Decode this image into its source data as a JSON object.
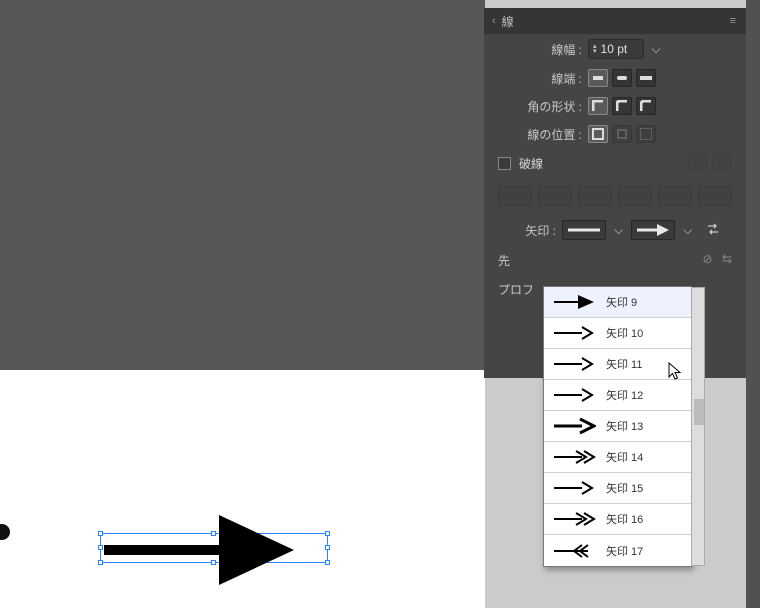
{
  "panel": {
    "title": "線",
    "stroke_weight_label": "線幅 :",
    "stroke_weight_value": "10 pt",
    "stroke_cap_label": "線端 :",
    "corner_label": "角の形状 :",
    "align_label": "線の位置 :",
    "dashed": {
      "label": "破線",
      "checked": false
    },
    "arrowheads_label": "矢印 :",
    "scale_label": "先",
    "profile_label": "プロフ"
  },
  "dropdown": {
    "highlighted_index": 0,
    "items": [
      {
        "label": "矢印 9",
        "arrow_type": "triangle-solid"
      },
      {
        "label": "矢印 10",
        "arrow_type": "line-open"
      },
      {
        "label": "矢印 11",
        "arrow_type": "line-open"
      },
      {
        "label": "矢印 12",
        "arrow_type": "line-open"
      },
      {
        "label": "矢印 13",
        "arrow_type": "line-heavy"
      },
      {
        "label": "矢印 14",
        "arrow_type": "double-open"
      },
      {
        "label": "矢印 15",
        "arrow_type": "line-open"
      },
      {
        "label": "矢印 16",
        "arrow_type": "double-open"
      },
      {
        "label": "矢印 17",
        "arrow_type": "feather"
      }
    ]
  },
  "window_controls": {
    "minimize": "—",
    "close": "✕"
  }
}
